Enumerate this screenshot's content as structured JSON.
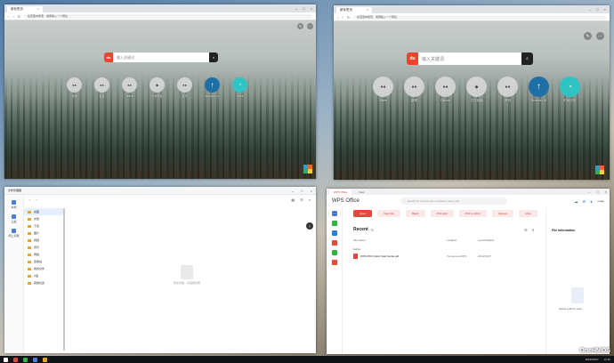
{
  "browser_tl": {
    "tab": "新标签页",
    "url": "在百度中搜索，或者输入一个网址",
    "search_placeholder": "输入关键词",
    "tiles": [
      "微博",
      "百度",
      "bilibili",
      "文件传输",
      "资讯",
      "Browser.AI",
      "Clock"
    ]
  },
  "browser_tr": {
    "tab": "新标签页",
    "url": "在百度中搜索，或者输入一个网址",
    "search_placeholder": "输入关键词",
    "tiles": [
      "Store",
      "新闻",
      "GitHub",
      "文件传输",
      "资讯",
      "Browser AI",
      "时间日历"
    ]
  },
  "filemgr": {
    "title": "文件管理器",
    "sidebar": [
      "本地",
      "云盘",
      "网上邻居"
    ],
    "tree": [
      "桌面",
      "文档",
      "下载",
      "图片",
      "视频",
      "音乐",
      "网络",
      "回收站",
      "我的文件",
      "U盘",
      "其他位置"
    ],
    "empty_text": "暂无内容，请选择目录"
  },
  "wps": {
    "tabs": [
      "WPS Office",
      "New"
    ],
    "logo": "WPS Office",
    "search": "Search for documents, templates, apps, tips",
    "login": "Login",
    "actions": [
      "Open",
      "New File",
      "Blank",
      "PDF Edit",
      "PDF to Word",
      "Convert",
      "More"
    ],
    "recent": "Recent",
    "cols": [
      "File Name",
      "Location",
      "Last Modified"
    ],
    "group": "Earlier",
    "file": {
      "name": "WPS PDF Quick Start Guide.pdf",
      "loc": "/home/user/WPS",
      "date": "2024/03/27"
    },
    "info_title": "File Information",
    "info_hint": "Select a file to view"
  },
  "taskbar": {
    "clock": "2024/03/27",
    "time": "11:20",
    "brand": "OneHMOS"
  }
}
